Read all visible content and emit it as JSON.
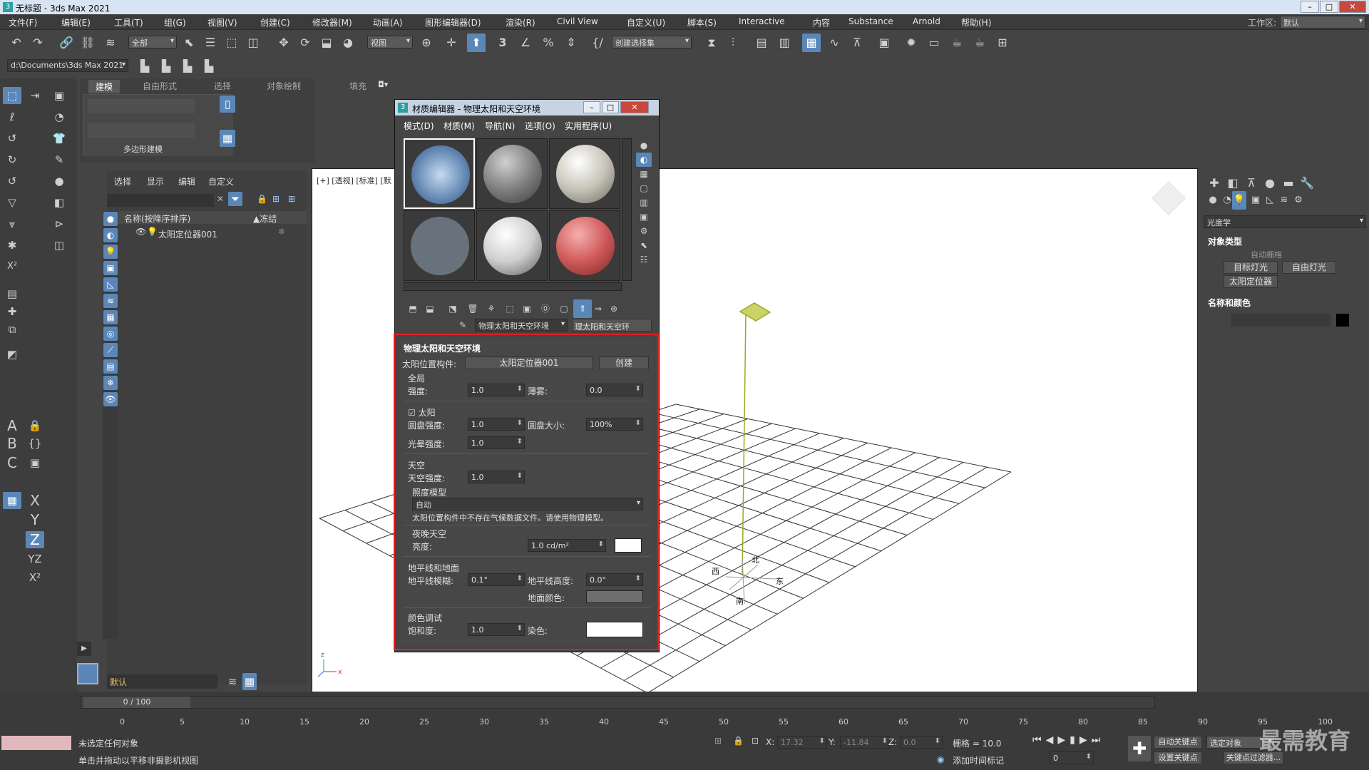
{
  "window": {
    "title": "无标题 - 3ds Max 2021",
    "workspace_label": "工作区:",
    "workspace_value": "默认"
  },
  "menu": [
    "文件(F)",
    "编辑(E)",
    "工具(T)",
    "组(G)",
    "视图(V)",
    "创建(C)",
    "修改器(M)",
    "动画(A)",
    "图形编辑器(D)",
    "渲染(R)",
    "Civil View",
    "自定义(U)",
    "脚本(S)",
    "Interactive",
    "内容",
    "Substance",
    "Arnold",
    "帮助(H)"
  ],
  "toolbar": {
    "filter_dropdown": "全部",
    "view_dropdown": "视图",
    "selset_dropdown": "创建选择集",
    "number_3": "3",
    "path": "d:\\Documents\\3ds Max 2021"
  },
  "ribbon": {
    "tabs": [
      "建模",
      "自由形式",
      "选择",
      "对象绘制",
      "填充"
    ],
    "group_label": "多边形建模"
  },
  "scene": {
    "tabs": [
      "选择",
      "显示",
      "编辑",
      "自定义"
    ],
    "col_name": "名称(按降序排序)",
    "col_frozen": "▲冻结",
    "item": "太阳定位器001",
    "layer": "默认"
  },
  "viewport": {
    "label": "[+] [透视] [标准] [默"
  },
  "right": {
    "dropdown": "光度学",
    "section1": "对象类型",
    "autogrid": "自动栅格",
    "btn_target": "目标灯光",
    "btn_free": "自由灯光",
    "btn_sun": "太阳定位器",
    "section2": "名称和颜色"
  },
  "mated": {
    "title": "材质编辑器 - 物理太阳和天空环境",
    "menus": [
      "模式(D)",
      "材质(M)",
      "导航(N)",
      "选项(O)",
      "实用程序(U)"
    ],
    "map_name": "物理太阳和天空环境",
    "map_type": "理太阳和天空环",
    "rollout_title": "物理太阳和天空环境",
    "sun_pos_label": "太阳位置构件:",
    "sun_pos_value": "太阳定位器001",
    "create": "创建",
    "global": "全局",
    "intensity_label": "强度:",
    "intensity": "1.0",
    "haze_label": "薄雾:",
    "haze": "0.0",
    "sun": "太阳",
    "disc_int_label": "圆盘强度:",
    "disc_int": "1.0",
    "disc_size_label": "圆盘大小:",
    "disc_size": "100%",
    "glow_label": "光晕强度:",
    "glow": "1.0",
    "sky": "天空",
    "sky_int_label": "天空强度:",
    "sky_int": "1.0",
    "illum_model": "照度模型",
    "illum_value": "自动",
    "warning": "太阳位置构件中不存在气候数据文件。请使用物理模型。",
    "night": "夜晚天空",
    "bright_label": "亮度:",
    "bright": "1.0 cd/m²",
    "horizon": "地平线和地面",
    "hblur_label": "地平线模糊:",
    "hblur": "0.1°",
    "hheight_label": "地平线高度:",
    "hheight": "0.0°",
    "ground_label": "地面颜色:",
    "color": "颜色调试",
    "sat_label": "饱和度:",
    "sat": "1.0",
    "tint_label": "染色:"
  },
  "bottom": {
    "frame": "0 / 100",
    "status1": "未选定任何对象",
    "status2": "单击并拖动以平移非摄影机视图",
    "x_label": "X:",
    "x": "17.32",
    "y_label": "Y:",
    "y": "-11.84",
    "z_label": "Z:",
    "z": "0.0",
    "grid": "栅格 = 10.0",
    "add_time": "添加时间标记",
    "autokey": "自动关键点",
    "setkey": "设置关键点",
    "selected": "选定对象",
    "filter": "关键点过滤器...",
    "frame_val": "0",
    "watermark": "最需教育",
    "ticks": [
      "0",
      "5",
      "10",
      "15",
      "20",
      "25",
      "30",
      "35",
      "40",
      "45",
      "50",
      "55",
      "60",
      "65",
      "70",
      "75",
      "80",
      "85",
      "90",
      "95",
      "100"
    ],
    "compass": [
      "北",
      "东",
      "南",
      "西"
    ]
  }
}
